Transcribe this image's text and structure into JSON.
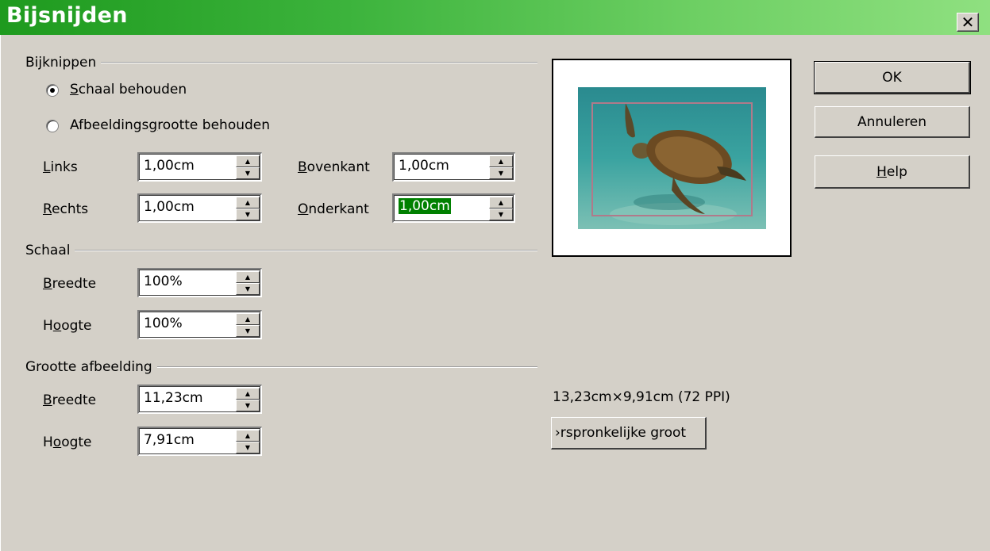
{
  "window": {
    "title": "Bijsnijden",
    "close_glyph": "✕"
  },
  "crop": {
    "group_label": "Bijknippen",
    "radio_keep_scale": "chaal behouden",
    "radio_keep_scale_key": "S",
    "radio_keep_size_a": "Afbeeldings",
    "radio_keep_size_key": "g",
    "radio_keep_size_b": "rootte behouden",
    "left_key": "L",
    "left_rest": "inks",
    "left_value": "1,00cm",
    "right_key": "R",
    "right_rest": "echts",
    "right_value": "1,00cm",
    "top_key": "B",
    "top_rest": "ovenkant",
    "top_value": "1,00cm",
    "bottom_key": "O",
    "bottom_rest": "nderkant",
    "bottom_value": "1,00cm"
  },
  "scale": {
    "group_label": "Schaal",
    "width_key": "B",
    "width_rest": "reedte",
    "width_value": "100%",
    "height_a": "H",
    "height_key": "o",
    "height_b": "ogte",
    "height_value": "100%"
  },
  "image_size": {
    "group_label": "Grootte afbeelding",
    "width_key": "B",
    "width_rest": "reedte",
    "width_value": "11,23cm",
    "height_a": "H",
    "height_key": "o",
    "height_b": "ogte",
    "height_value": "7,91cm"
  },
  "info": {
    "original_size_text": "13,23cm×9,91cm (72 PPI)",
    "original_size_button": "›rspronkelijke groot"
  },
  "buttons": {
    "ok": "OK",
    "cancel": "Annuleren",
    "help_key": "H",
    "help_rest": "elp"
  },
  "icons": {
    "spin_up": "▲",
    "spin_down": "▼",
    "preview_image": "sea-turtle-photo"
  },
  "colors": {
    "title_gradient_start": "#1e9a1e",
    "title_gradient_end": "#8fe080",
    "selection": "#008000",
    "dialog_bg": "#d4d0c8"
  }
}
